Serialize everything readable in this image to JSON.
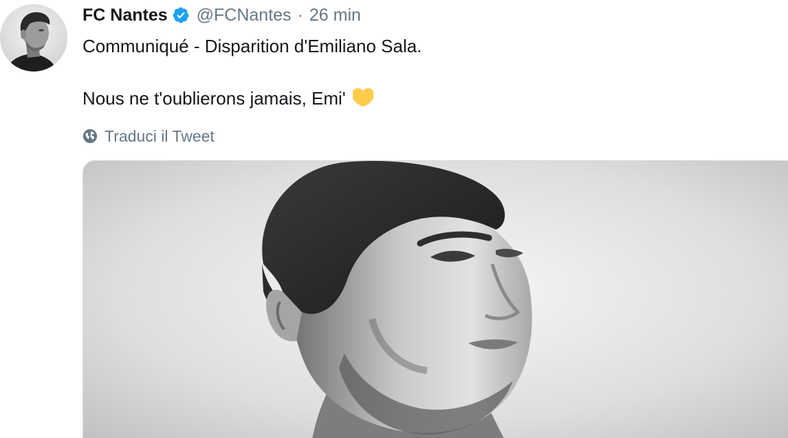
{
  "tweet": {
    "display_name": "FC Nantes",
    "handle": "@FCNantes",
    "separator": "·",
    "timestamp": "26 min",
    "verified": true,
    "text_line1": "Communiqué - Disparition d'Emiliano Sala.",
    "text_line2": "Nous ne t'oublierons jamais, Emi'",
    "emoji": "yellow-heart-icon",
    "translate_label": "Traduci il Tweet"
  },
  "colors": {
    "verified": "#1da1f2",
    "heart": "#ffcc4d",
    "secondary_text": "#657786",
    "primary_text": "#14171a"
  }
}
